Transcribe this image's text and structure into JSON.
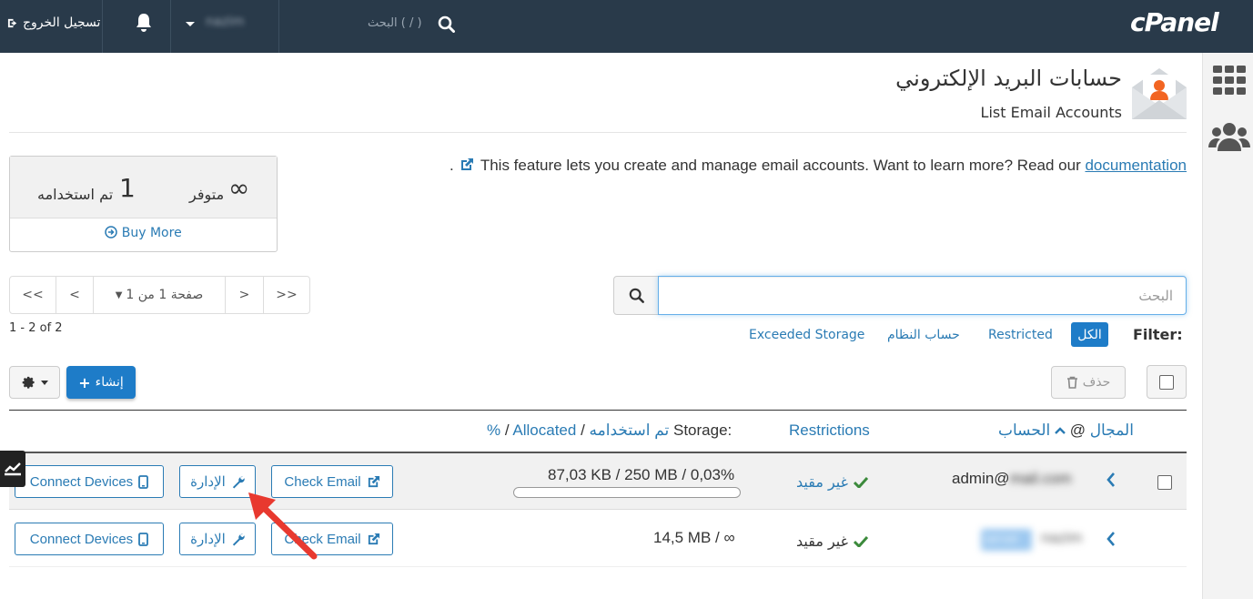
{
  "topbar": {
    "logout_label": "تسجيل الخروج",
    "username": "nazim",
    "search_placeholder": "البحث ( / )",
    "logo_text": "cPanel"
  },
  "header": {
    "title": "حسابات البريد الإلكتروني",
    "subtitle": "List Email Accounts",
    "description": "This feature lets you create and manage email accounts. Want to learn more? Read our",
    "doc_link": "documentation",
    "trailing": "."
  },
  "stats": {
    "available_value": "∞",
    "available_label": "متوفر",
    "used_value": "1",
    "used_label": "تم استخدامه",
    "buy_more": "Buy More"
  },
  "search": {
    "placeholder": "البحث"
  },
  "pagination": {
    "first": "<<",
    "prev": "<",
    "page": "صفحة 1 من 1",
    "next": ">",
    "last": ">>",
    "range": "1 - 2 of 2"
  },
  "filters": {
    "label": "Filter:",
    "all": "الكل",
    "restricted": "Restricted",
    "system": "حساب النظام",
    "exceeded": "Exceeded Storage"
  },
  "actions": {
    "delete": "حذف",
    "create": "إنشاء"
  },
  "table": {
    "headers": {
      "account": "الحساب",
      "at": "@",
      "domain": "المجال",
      "restrictions": "Restrictions",
      "storage_prefix": "Storage:",
      "used": "تم استخدامه",
      "sep": "/",
      "allocated": "Allocated",
      "percent": "%"
    },
    "rows": [
      {
        "account": "admin@",
        "domain": "mail.com",
        "restriction": "غير مقيد",
        "storage": "87,03 KB / 250 MB / 0,03%",
        "usage_percent": 0.03,
        "check_email": "Check Email",
        "manage": "الإدارة",
        "connect": "Connect Devices"
      },
      {
        "account": "nazim",
        "domain": "server",
        "restriction": "غير مقيد",
        "storage": "14,5 MB / ∞",
        "check_email": "Check Email",
        "manage": "الإدارة",
        "connect": "Connect Devices"
      }
    ]
  },
  "colors": {
    "topbar": "#293a4a",
    "accent": "#1e7cc8",
    "link": "#2a7bb4",
    "check": "#3c8a3c",
    "arrow": "#e8392f"
  }
}
